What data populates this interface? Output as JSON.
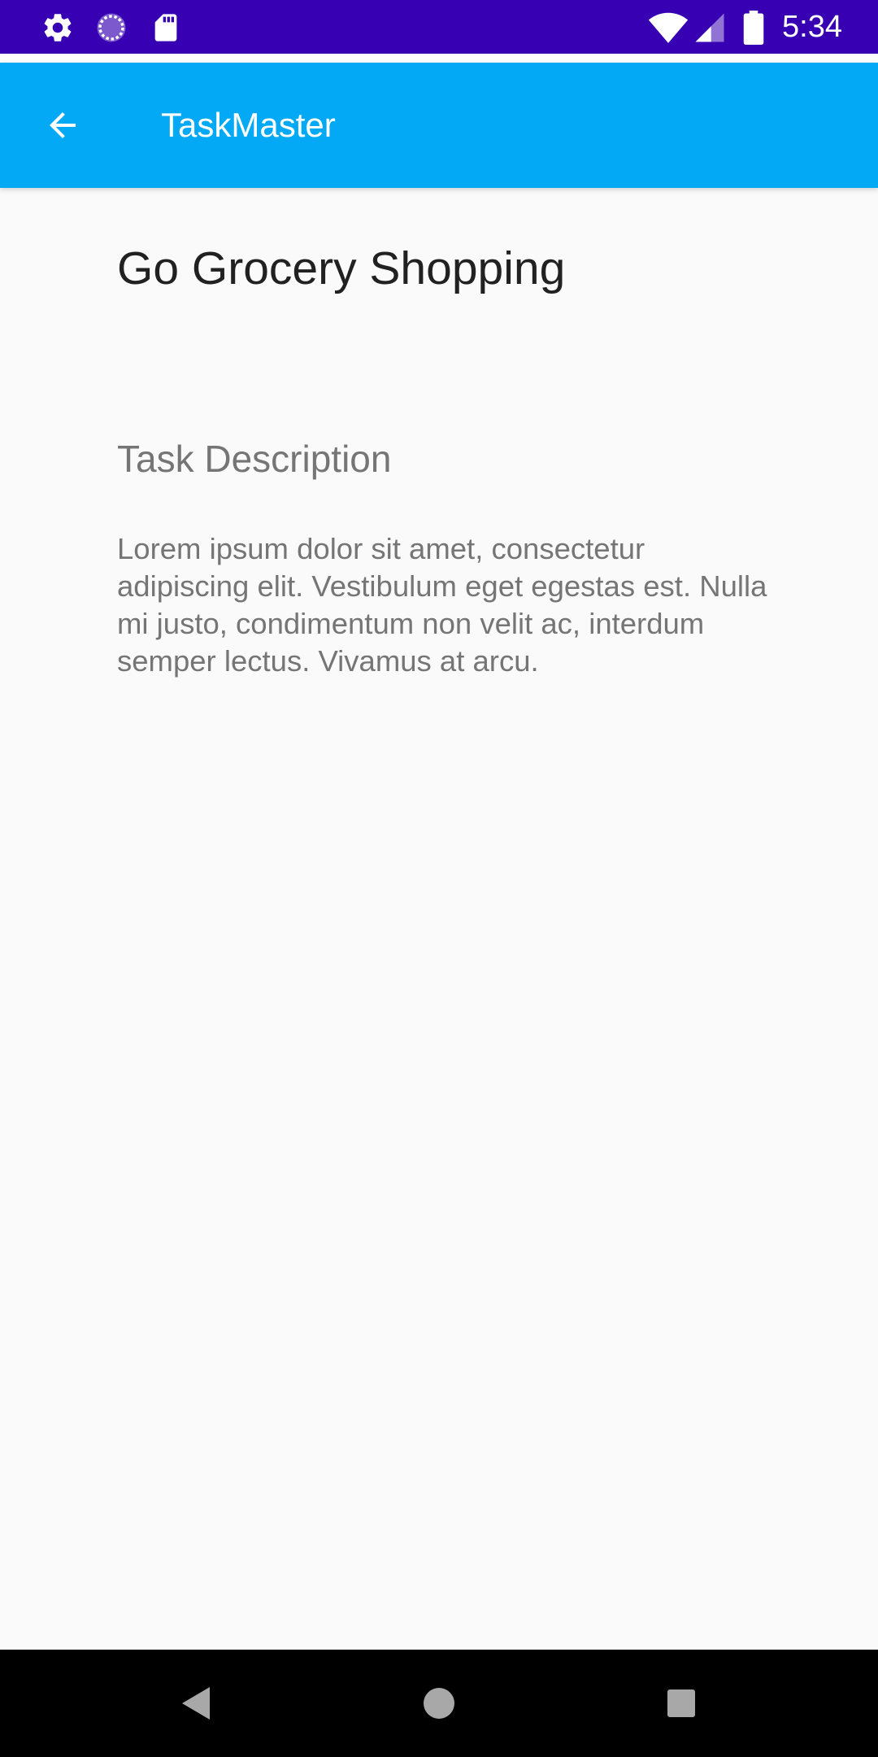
{
  "status_bar": {
    "time": "5:34",
    "icons": [
      "gear-icon",
      "sync-circle-icon",
      "sd-card-icon",
      "wifi-icon",
      "cell-signal-icon",
      "battery-icon"
    ],
    "background_color": "#3700b3"
  },
  "app_bar": {
    "title": "TaskMaster",
    "back_icon": "arrow-back-icon",
    "background_color": "#03a9f4"
  },
  "task": {
    "title": "Go Grocery Shopping",
    "description_label": "Task Description",
    "description": "Lorem ipsum dolor sit amet, consectetur adipiscing elit. Vestibulum eget egestas est. Nulla mi justo, condimentum non velit ac, interdum semper lectus. Vivamus at arcu."
  },
  "nav_bar": {
    "buttons": [
      "back-triangle-icon",
      "home-circle-icon",
      "recents-square-icon"
    ]
  }
}
